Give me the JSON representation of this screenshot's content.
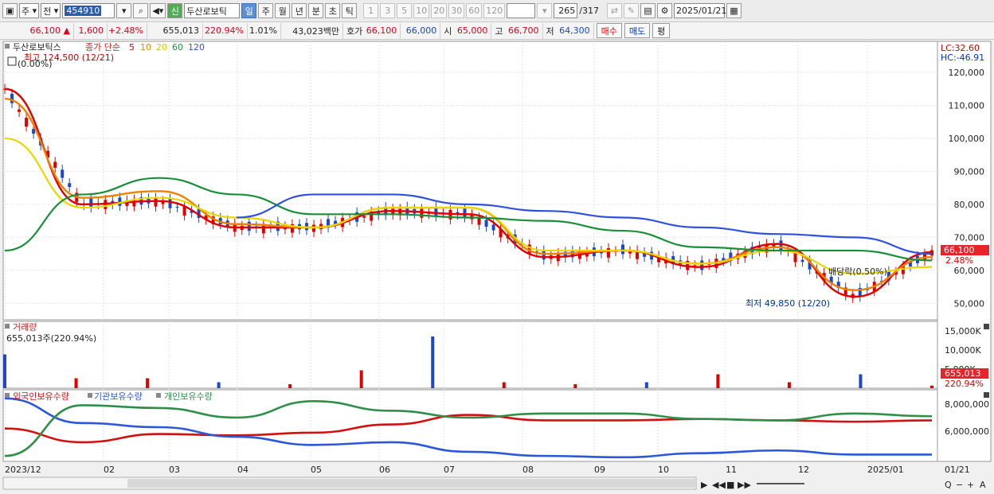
{
  "toolbar": {
    "period_select": "주",
    "compare_select": "전",
    "code": "454910",
    "new_badge": "신",
    "stock_name": "두산로보틱",
    "period_tabs": [
      "일",
      "주",
      "월",
      "년",
      "분",
      "초",
      "틱"
    ],
    "active_tab": "일",
    "interval_buttons": [
      "1",
      "3",
      "5",
      "10",
      "20",
      "30",
      "60",
      "120"
    ],
    "count": "265",
    "total": "/317",
    "date": "2025/01/21"
  },
  "quote": {
    "price": "66,100",
    "change": "1,600",
    "change_pct": "+2.48%",
    "volume": "655,013",
    "volume_ratio": "220.94%",
    "turnover": "1.01%",
    "amount": "43,023백만",
    "ask_label": "호가",
    "ask1": "66,100",
    "ask2": "66,000",
    "open_label": "시",
    "open": "65,000",
    "high_label": "고",
    "high": "66,700",
    "low_label": "저",
    "low": "64,300",
    "buy_label": "매수",
    "sell_label": "매도",
    "eval_label": "평"
  },
  "legend": {
    "name": "두산로보틱스",
    "type": "종가 단순",
    "ma": [
      {
        "label": "5",
        "color": "#e00000"
      },
      {
        "label": "10",
        "color": "#f08000"
      },
      {
        "label": "20",
        "color": "#e6d800"
      },
      {
        "label": "60",
        "color": "#1a8f3a"
      },
      {
        "label": "120",
        "color": "#3050e0"
      }
    ],
    "high_note": "최고 124,500 (12/21)",
    "pct_note": "(0.00%)",
    "low_note": "최저 49,850 (12/20)",
    "dividend_note": "배당락(0.50%)",
    "lc": "LC:32.60",
    "hc": "HC:-46.91",
    "price_tag": "66,100",
    "pct_tag": "2.48%"
  },
  "volume_panel": {
    "title": "거래량",
    "summary": "655,013주(220.94%)",
    "tag": "655,013",
    "pct_tag": "220.94%",
    "axis": [
      "15,000K",
      "10,000K",
      "5,000K"
    ]
  },
  "holdings_panel": {
    "series": [
      {
        "label": "외국인보유수량",
        "color": "#d31010"
      },
      {
        "label": "기관보유수량",
        "color": "#2b57d8"
      },
      {
        "label": "개인보유수량",
        "color": "#2f8f4a"
      }
    ],
    "axis": [
      "8,000,000",
      "6,000,000"
    ]
  },
  "price_axis": [
    "120,000",
    "110,000",
    "100,000",
    "90,000",
    "80,000",
    "70,000",
    "60,000",
    "50,000"
  ],
  "x_axis": [
    "2023/12",
    "02",
    "03",
    "04",
    "05",
    "06",
    "07",
    "08",
    "09",
    "10",
    "11",
    "12",
    "2025/01",
    "01/21"
  ],
  "chart_data": {
    "type": "line",
    "title": "두산로보틱스",
    "x": [
      "2023/12",
      "02",
      "03",
      "04",
      "05",
      "06",
      "07",
      "08",
      "09",
      "10",
      "11",
      "12",
      "2025/01"
    ],
    "ylim": [
      45000,
      127000
    ],
    "series": [
      {
        "name": "5",
        "values": [
          115000,
          80000,
          81000,
          73000,
          73000,
          78000,
          77000,
          64000,
          66000,
          61000,
          68000,
          52000,
          65500
        ]
      },
      {
        "name": "10",
        "values": [
          112000,
          82000,
          84000,
          74000,
          73000,
          79000,
          79000,
          65000,
          66000,
          62000,
          67000,
          54000,
          64000
        ]
      },
      {
        "name": "20",
        "values": [
          100000,
          79000,
          82000,
          76000,
          73000,
          79000,
          79000,
          66000,
          66000,
          62000,
          66000,
          59000,
          61000
        ]
      },
      {
        "name": "60",
        "values": [
          66000,
          83000,
          88000,
          83000,
          77000,
          77000,
          76000,
          75000,
          72000,
          67000,
          66000,
          66000,
          63000
        ]
      },
      {
        "name": "120",
        "values": [
          null,
          null,
          null,
          76000,
          83000,
          83000,
          80000,
          78000,
          76000,
          73000,
          71000,
          70000,
          65000
        ]
      }
    ],
    "volume_k": [
      8500,
      2500,
      2500,
      1500,
      1000,
      4500,
      13000,
      1500,
      1000,
      1500,
      3500,
      1500,
      3500,
      655
    ],
    "holdings": {
      "외국인보유수량": [
        6200000,
        5200000,
        5800000,
        5700000,
        5900000,
        6500000,
        7200000,
        6800000,
        6800000,
        6900000,
        6800000,
        6700000,
        6800000
      ],
      "기관보유수량": [
        8400000,
        6600000,
        6300000,
        5600000,
        5000000,
        5200000,
        4500000,
        4200000,
        4100000,
        4400000,
        4600000,
        4300000,
        4300000
      ],
      "개인보유수량": [
        4200000,
        7900000,
        7700000,
        7000000,
        8200000,
        7500000,
        7000000,
        7300000,
        7300000,
        6900000,
        6800000,
        7300000,
        7100000
      ]
    }
  }
}
